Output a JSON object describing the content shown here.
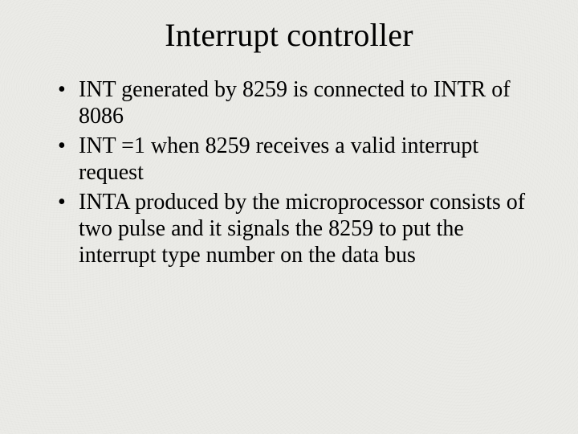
{
  "title": "Interrupt controller",
  "bullets": [
    "INT generated by 8259 is connected to INTR of 8086",
    "INT =1 when 8259 receives a valid interrupt request",
    "INTA produced by the microprocessor consists of two pulse and it signals the 8259 to put the interrupt type number on the data bus"
  ]
}
